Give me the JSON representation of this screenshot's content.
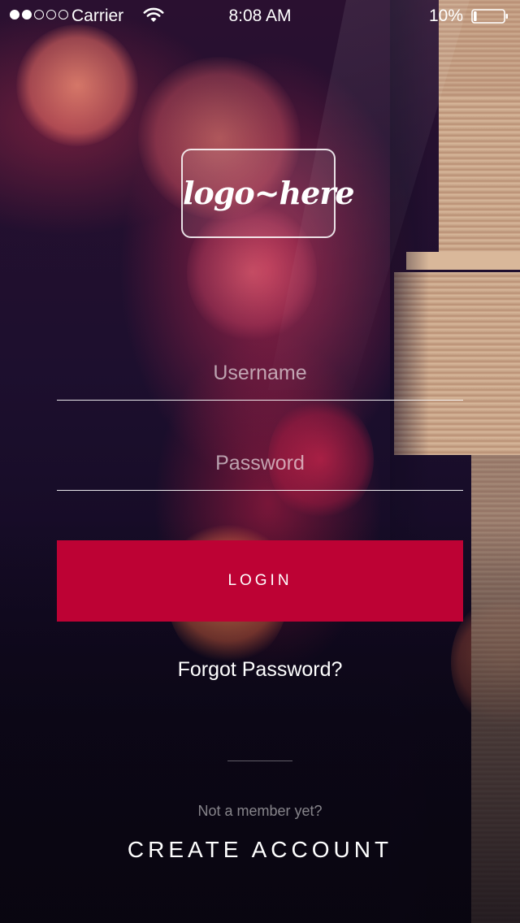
{
  "status_bar": {
    "signal_filled": 2,
    "signal_total": 5,
    "carrier": "Carrier",
    "wifi_icon": "wifi-icon",
    "time": "8:08 AM",
    "battery_percent": "10%",
    "battery_icon": "battery-icon",
    "battery_level": 0.1
  },
  "logo": {
    "text": "logo~here"
  },
  "form": {
    "username_placeholder": "Username",
    "password_placeholder": "Password",
    "login_label": "LOGIN",
    "forgot_password": "Forgot Password?"
  },
  "footer": {
    "not_member": "Not a member yet?",
    "create_account": "CREATE ACCOUNT"
  },
  "colors": {
    "accent": "#bd0234",
    "text": "#ffffff"
  }
}
